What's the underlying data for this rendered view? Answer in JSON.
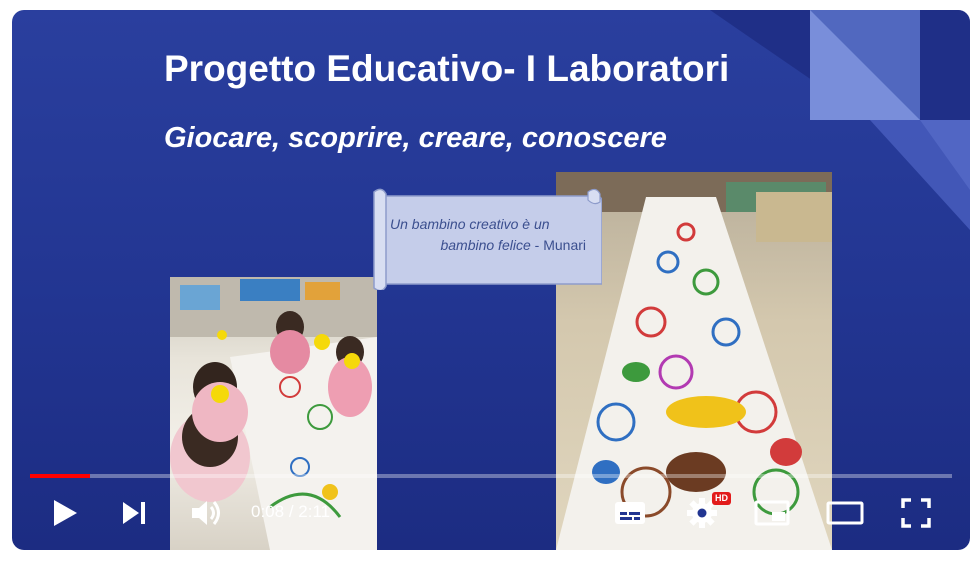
{
  "slide": {
    "title": "Progetto Educativo- I Laboratori",
    "subtitle": "Giocare, scoprire, creare, conoscere",
    "quote_line1": "Un bambino creativo è un",
    "quote_line2": "bambino felice",
    "quote_sep": " - ",
    "quote_author": "Munari"
  },
  "player": {
    "current_time": "0:08",
    "separator": " / ",
    "duration": "2:11",
    "progress_fraction": 0.065,
    "hd_badge": "HD"
  },
  "colors": {
    "slide_blue": "#2a3f9e",
    "progress_red": "#ff0000",
    "hd_red": "#e21b1b"
  },
  "icons": [
    "play-icon",
    "next-icon",
    "volume-icon",
    "subtitles-icon",
    "settings-icon",
    "miniplayer-icon",
    "theater-mode-icon",
    "fullscreen-icon"
  ]
}
